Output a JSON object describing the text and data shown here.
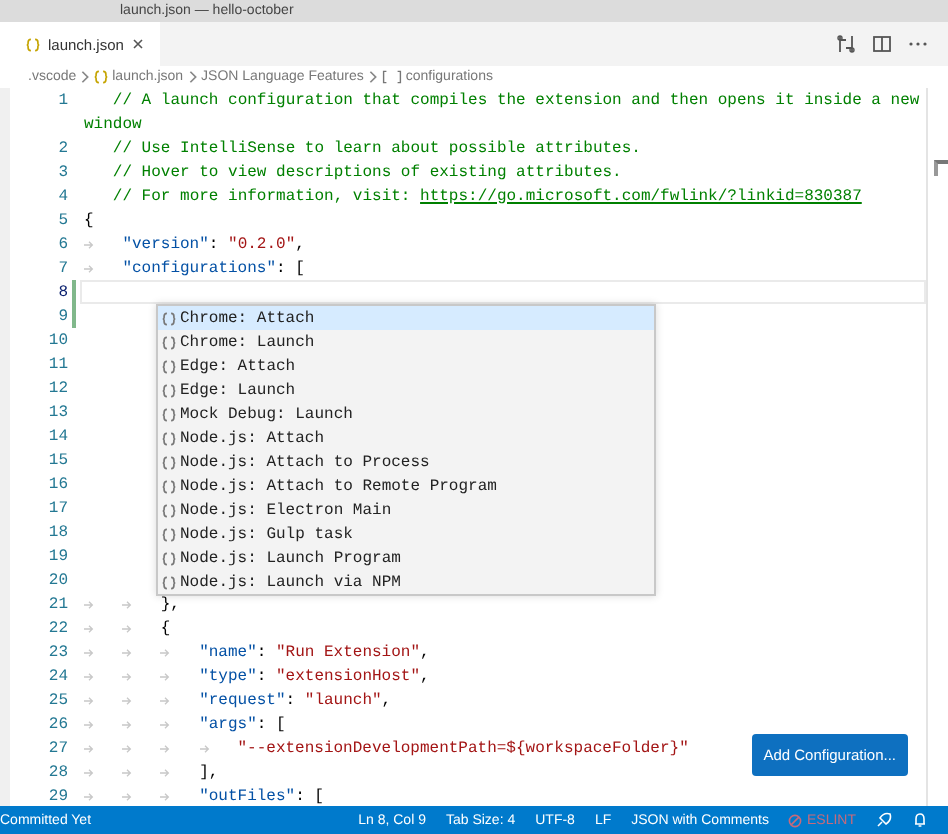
{
  "window": {
    "title": "launch.json — hello-october"
  },
  "tabs": [
    {
      "label": "launch.json",
      "selected": true
    }
  ],
  "breadcrumbs": [
    {
      "label": ".vscode",
      "kind": "folder"
    },
    {
      "label": "launch.json",
      "kind": "file"
    },
    {
      "label": "JSON Language Features",
      "kind": "provider"
    },
    {
      "label": "configurations",
      "kind": "array"
    }
  ],
  "editor": {
    "lines": [
      {
        "number": "1",
        "current": false,
        "modified": false,
        "tokens": [
          {
            "kind": "comment",
            "text": "   // A launch configuration that compiles the extension and then opens it inside a new"
          }
        ],
        "wrap": "window"
      },
      {
        "number": "2",
        "current": false,
        "modified": false,
        "tokens": [
          {
            "kind": "comment",
            "text": "   // Use IntelliSense to learn about possible attributes."
          }
        ]
      },
      {
        "number": "3",
        "current": false,
        "modified": false,
        "tokens": [
          {
            "kind": "comment",
            "text": "   // Hover to view descriptions of existing attributes."
          }
        ]
      },
      {
        "number": "4",
        "current": false,
        "modified": false,
        "tokens": [
          {
            "kind": "comment",
            "text": "   // For more information, visit: "
          },
          {
            "kind": "link",
            "text": "https://go.microsoft.com/fwlink/?linkid=830387"
          }
        ]
      },
      {
        "number": "5",
        "current": false,
        "modified": false,
        "tokens": [
          {
            "kind": "punct",
            "text": "{"
          }
        ]
      },
      {
        "number": "6",
        "current": false,
        "modified": false,
        "tokens": [
          {
            "kind": "key",
            "text": "\t\"version\""
          },
          {
            "kind": "punct",
            "text": ": "
          },
          {
            "kind": "string",
            "text": "\"0.2.0\""
          },
          {
            "kind": "punct",
            "text": ","
          }
        ]
      },
      {
        "number": "7",
        "current": false,
        "modified": false,
        "tokens": [
          {
            "kind": "key",
            "text": "\t\"configurations\""
          },
          {
            "kind": "punct",
            "text": ": ["
          }
        ]
      },
      {
        "number": "8",
        "current": true,
        "modified": true
      },
      {
        "number": "9",
        "current": false,
        "modified": true
      },
      {
        "number": "10",
        "current": false,
        "modified": false
      },
      {
        "number": "11",
        "current": false,
        "modified": false
      },
      {
        "number": "12",
        "current": false,
        "modified": false
      },
      {
        "number": "13",
        "current": false,
        "modified": false
      },
      {
        "number": "14",
        "current": false,
        "modified": false
      },
      {
        "number": "15",
        "current": false,
        "modified": false
      },
      {
        "number": "16",
        "current": false,
        "modified": false
      },
      {
        "number": "17",
        "current": false,
        "modified": false
      },
      {
        "number": "18",
        "current": false,
        "modified": false
      },
      {
        "number": "19",
        "current": false,
        "modified": false
      },
      {
        "number": "20",
        "current": false,
        "modified": false
      },
      {
        "number": "21",
        "current": false,
        "modified": false,
        "tokens": [
          {
            "kind": "punct",
            "text": "\t\t},"
          }
        ]
      },
      {
        "number": "22",
        "current": false,
        "modified": false,
        "tokens": [
          {
            "kind": "punct",
            "text": "\t\t{"
          }
        ]
      },
      {
        "number": "23",
        "current": false,
        "modified": false,
        "tokens": [
          {
            "kind": "key",
            "text": "\t\t\t\"name\""
          },
          {
            "kind": "punct",
            "text": ": "
          },
          {
            "kind": "string",
            "text": "\"Run Extension\""
          },
          {
            "kind": "punct",
            "text": ","
          }
        ]
      },
      {
        "number": "24",
        "current": false,
        "modified": false,
        "tokens": [
          {
            "kind": "key",
            "text": "\t\t\t\"type\""
          },
          {
            "kind": "punct",
            "text": ": "
          },
          {
            "kind": "string",
            "text": "\"extensionHost\""
          },
          {
            "kind": "punct",
            "text": ","
          }
        ]
      },
      {
        "number": "25",
        "current": false,
        "modified": false,
        "tokens": [
          {
            "kind": "key",
            "text": "\t\t\t\"request\""
          },
          {
            "kind": "punct",
            "text": ": "
          },
          {
            "kind": "string",
            "text": "\"launch\""
          },
          {
            "kind": "punct",
            "text": ","
          }
        ]
      },
      {
        "number": "26",
        "current": false,
        "modified": false,
        "tokens": [
          {
            "kind": "key",
            "text": "\t\t\t\"args\""
          },
          {
            "kind": "punct",
            "text": ": ["
          }
        ]
      },
      {
        "number": "27",
        "current": false,
        "modified": false,
        "tokens": [
          {
            "kind": "string",
            "text": "\t\t\t\t\"--extensionDevelopmentPath=${workspaceFolder}\""
          }
        ]
      },
      {
        "number": "28",
        "current": false,
        "modified": false,
        "tokens": [
          {
            "kind": "punct",
            "text": "\t\t\t],"
          }
        ]
      },
      {
        "number": "29",
        "current": false,
        "modified": false,
        "tokens": [
          {
            "kind": "key",
            "text": "\t\t\t\"outFiles\""
          },
          {
            "kind": "punct",
            "text": ": ["
          }
        ]
      }
    ]
  },
  "suggestions": [
    {
      "label": "Chrome: Attach",
      "selected": true
    },
    {
      "label": "Chrome: Launch",
      "selected": false
    },
    {
      "label": "Edge: Attach",
      "selected": false
    },
    {
      "label": "Edge: Launch",
      "selected": false
    },
    {
      "label": "Mock Debug: Launch",
      "selected": false
    },
    {
      "label": "Node.js: Attach",
      "selected": false
    },
    {
      "label": "Node.js: Attach to Process",
      "selected": false
    },
    {
      "label": "Node.js: Attach to Remote Program",
      "selected": false
    },
    {
      "label": "Node.js: Electron Main",
      "selected": false
    },
    {
      "label": "Node.js: Gulp task",
      "selected": false
    },
    {
      "label": "Node.js: Launch Program",
      "selected": false
    },
    {
      "label": "Node.js: Launch via NPM",
      "selected": false
    }
  ],
  "add_configuration_button": "Add Configuration...",
  "status_bar": {
    "left": [
      "Committed Yet"
    ],
    "right": [
      {
        "kind": "text",
        "text": "Ln 8, Col 9"
      },
      {
        "kind": "text",
        "text": "Tab Size: 4"
      },
      {
        "kind": "text",
        "text": "UTF-8"
      },
      {
        "kind": "text",
        "text": "LF"
      },
      {
        "kind": "text",
        "text": "JSON with Comments"
      },
      {
        "kind": "eslint",
        "text": "ESLINT"
      }
    ]
  }
}
